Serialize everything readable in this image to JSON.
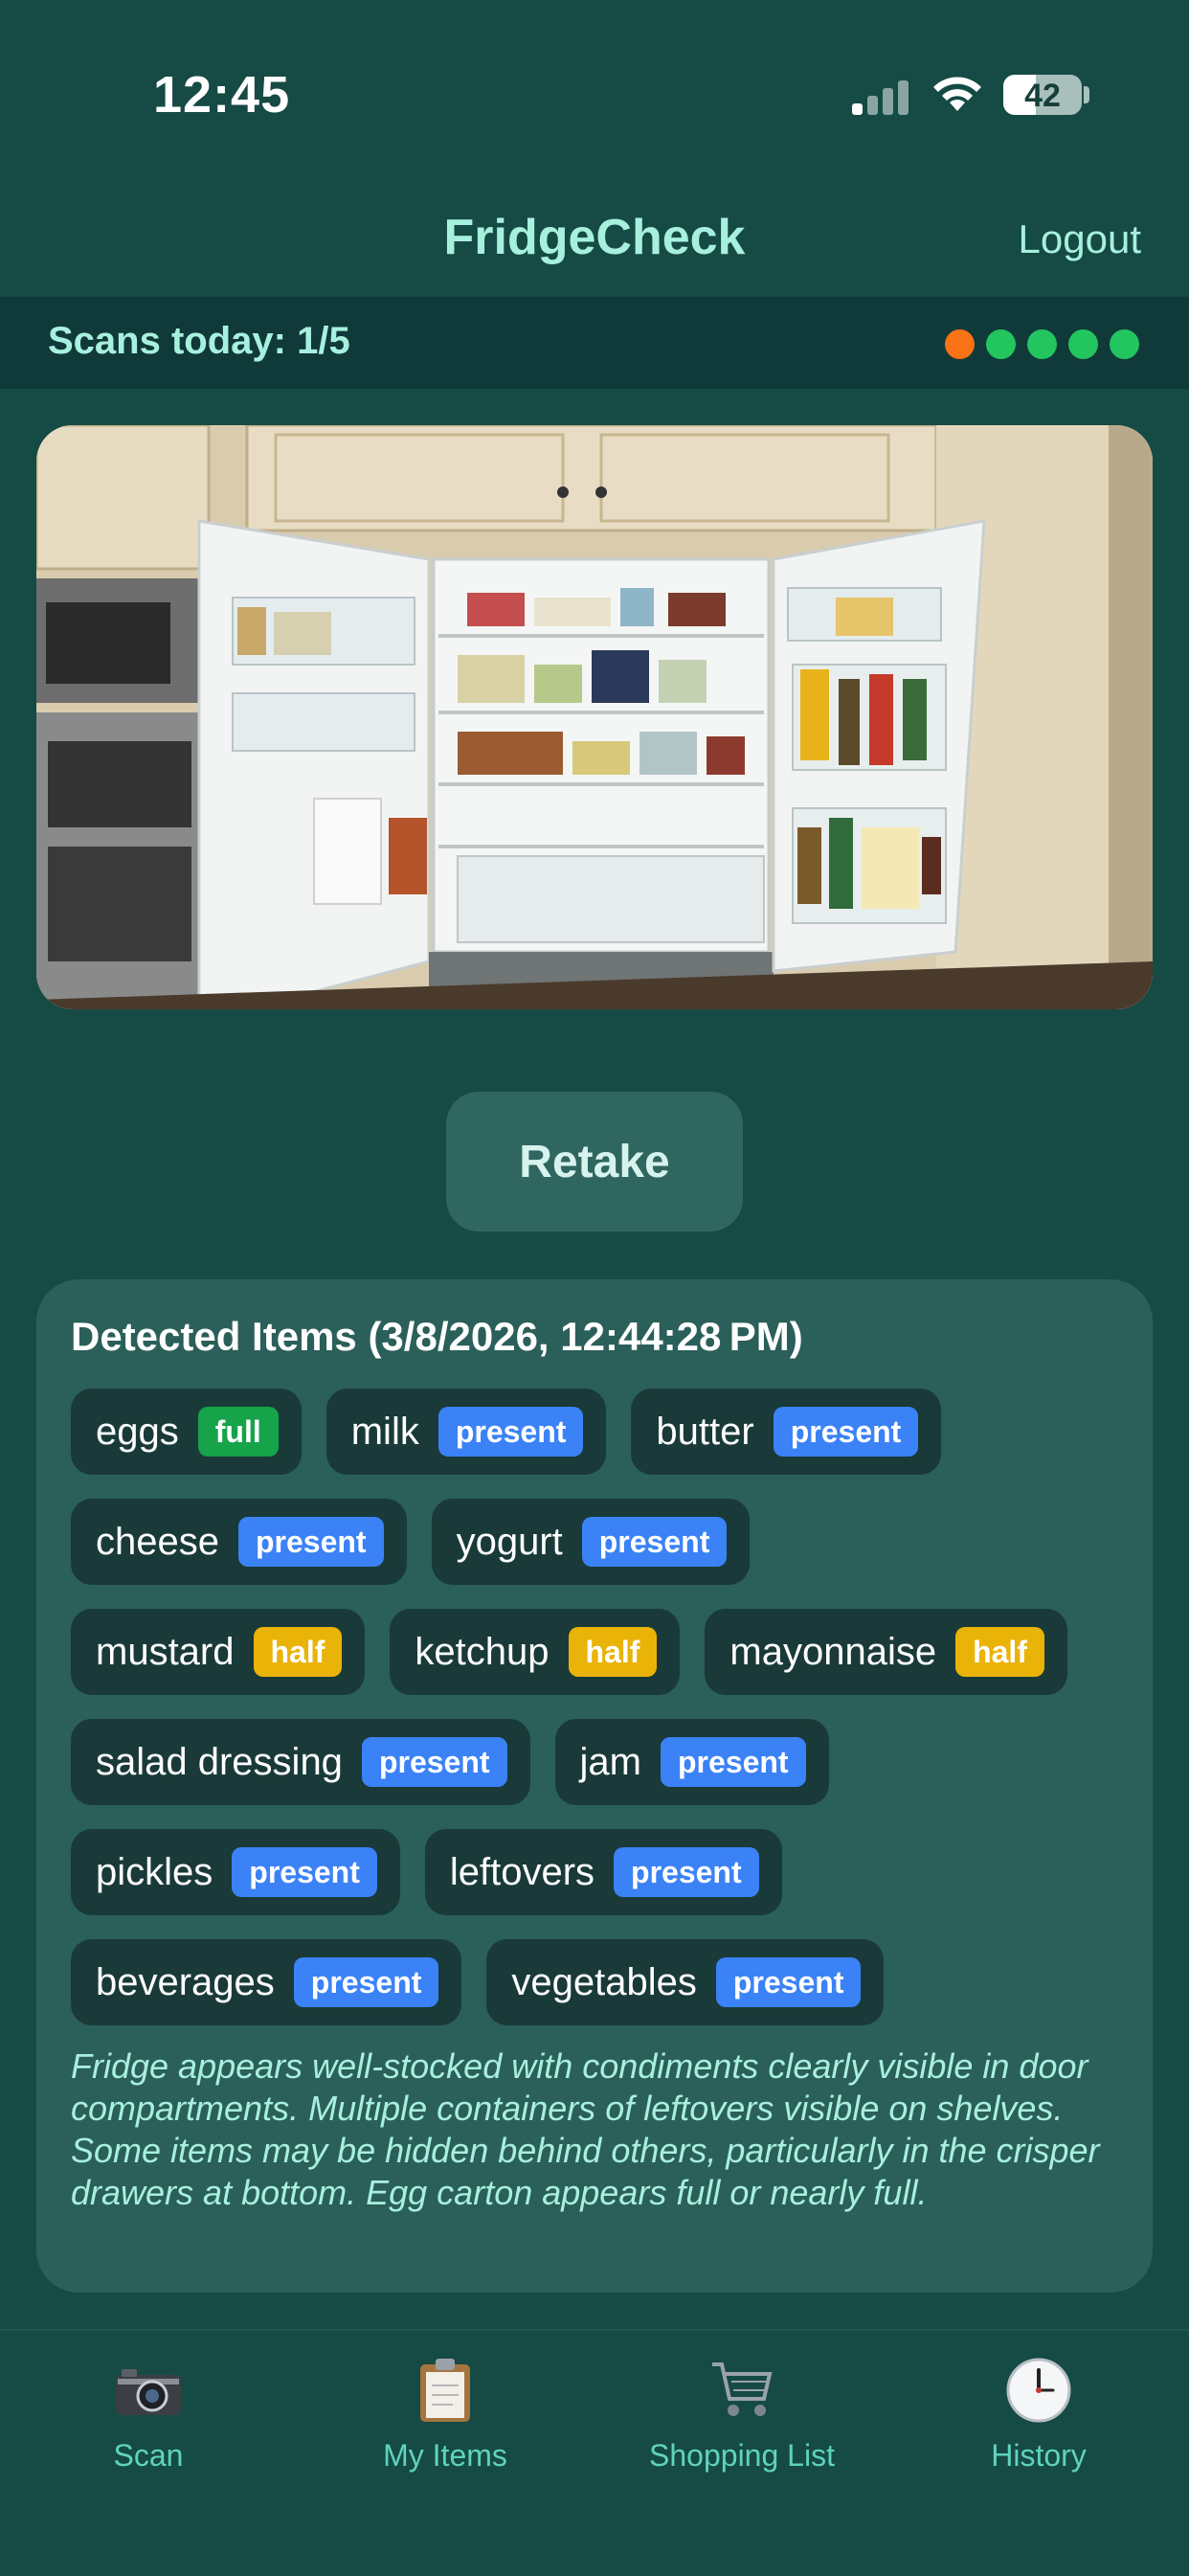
{
  "status_bar": {
    "time": "12:45",
    "battery": "42"
  },
  "nav": {
    "title": "FridgeCheck",
    "logout_label": "Logout"
  },
  "scans": {
    "label": "Scans today: 1/5",
    "dots": [
      {
        "color": "#f97316"
      },
      {
        "color": "#22c55e"
      },
      {
        "color": "#22c55e"
      },
      {
        "color": "#22c55e"
      },
      {
        "color": "#22c55e"
      }
    ]
  },
  "retake_label": "Retake",
  "detected": {
    "title": "Detected Items (3/8/2026, 12:44:28 PM)",
    "rows": [
      [
        {
          "name": "eggs",
          "status": "full"
        },
        {
          "name": "milk",
          "status": "present"
        },
        {
          "name": "butter",
          "status": "present"
        }
      ],
      [
        {
          "name": "cheese",
          "status": "present"
        },
        {
          "name": "yogurt",
          "status": "present"
        }
      ],
      [
        {
          "name": "mustard",
          "status": "half"
        },
        {
          "name": "ketchup",
          "status": "half"
        },
        {
          "name": "mayonnaise",
          "status": "half"
        }
      ],
      [
        {
          "name": "salad dressing",
          "status": "present"
        },
        {
          "name": "jam",
          "status": "present"
        }
      ],
      [
        {
          "name": "pickles",
          "status": "present"
        },
        {
          "name": "leftovers",
          "status": "present"
        }
      ],
      [
        {
          "name": "beverages",
          "status": "present"
        },
        {
          "name": "vegetables",
          "status": "present"
        }
      ]
    ],
    "summary": "Fridge appears well-stocked with condiments clearly visible in door compartments. Multiple containers of leftovers visible on shelves. Some items may be hidden behind others, particularly in the crisper drawers at bottom. Egg carton appears full or nearly full."
  },
  "tabs": [
    {
      "label": "Scan",
      "icon": "camera-icon"
    },
    {
      "label": "My Items",
      "icon": "clipboard-icon"
    },
    {
      "label": "Shopping List",
      "icon": "cart-icon"
    },
    {
      "label": "History",
      "icon": "clock-icon"
    }
  ]
}
